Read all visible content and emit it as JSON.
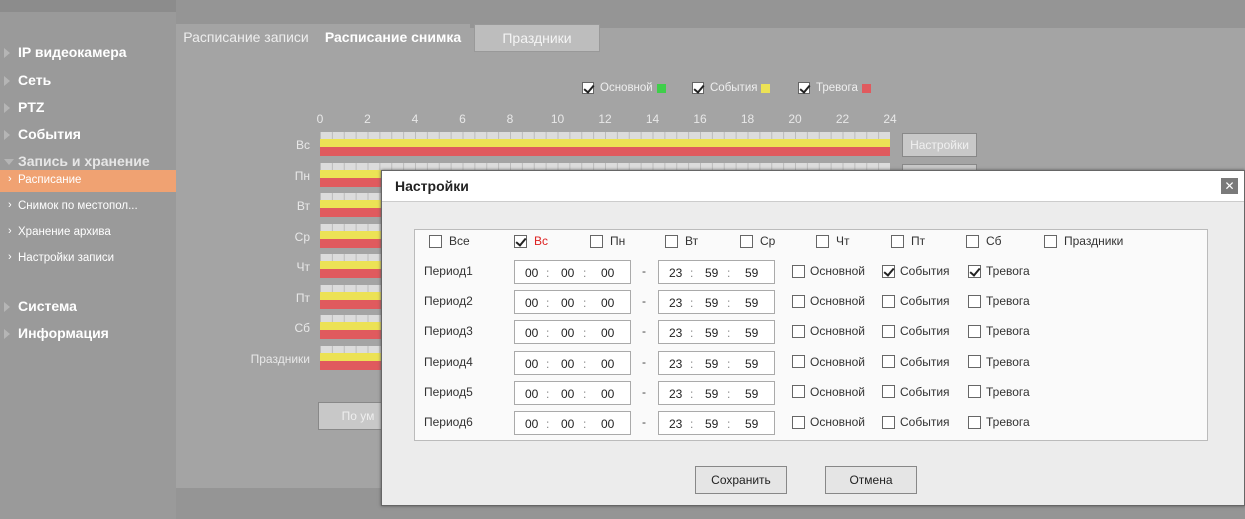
{
  "sidebar": {
    "items": [
      {
        "label": "IP видеокамера"
      },
      {
        "label": "Сеть"
      },
      {
        "label": "PTZ"
      },
      {
        "label": "События"
      },
      {
        "label": "Запись и хранение"
      },
      {
        "label": "Система"
      },
      {
        "label": "Информация"
      }
    ],
    "sub_items": [
      {
        "label": "Расписание",
        "active": true
      },
      {
        "label": "Снимок по местопол..."
      },
      {
        "label": "Хранение архива"
      },
      {
        "label": "Настройки записи"
      }
    ]
  },
  "tabs": [
    {
      "label": "Расписание записи"
    },
    {
      "label": "Расписание снимка",
      "active": true
    },
    {
      "label": "Праздники"
    }
  ],
  "legend": [
    {
      "label": "Основной",
      "checked": true,
      "color": "#3fcf4a"
    },
    {
      "label": "События",
      "checked": true,
      "color": "#ece255"
    },
    {
      "label": "Тревога",
      "checked": true,
      "color": "#e05a5e"
    }
  ],
  "hours": [
    "0",
    "2",
    "4",
    "6",
    "8",
    "10",
    "12",
    "14",
    "16",
    "18",
    "20",
    "22",
    "24"
  ],
  "days": [
    "Вс",
    "Пн",
    "Вт",
    "Ср",
    "Чт",
    "Пт",
    "Сб",
    "Праздники"
  ],
  "settings_button": "Настройки",
  "default_button": "По ум",
  "modal": {
    "title": "Настройки",
    "close": "✕",
    "day_options": [
      {
        "label": "Все",
        "checked": false
      },
      {
        "label": "Вс",
        "checked": true
      },
      {
        "label": "Пн",
        "checked": false
      },
      {
        "label": "Вт",
        "checked": false
      },
      {
        "label": "Ср",
        "checked": false
      },
      {
        "label": "Чт",
        "checked": false
      },
      {
        "label": "Пт",
        "checked": false
      },
      {
        "label": "Сб",
        "checked": false
      },
      {
        "label": "Праздники",
        "checked": false
      }
    ],
    "periods": [
      {
        "name": "Период1",
        "start": [
          "00",
          "00",
          "00"
        ],
        "end": [
          "23",
          "59",
          "59"
        ],
        "main": false,
        "events": true,
        "alarm": true
      },
      {
        "name": "Период2",
        "start": [
          "00",
          "00",
          "00"
        ],
        "end": [
          "23",
          "59",
          "59"
        ],
        "main": false,
        "events": false,
        "alarm": false
      },
      {
        "name": "Период3",
        "start": [
          "00",
          "00",
          "00"
        ],
        "end": [
          "23",
          "59",
          "59"
        ],
        "main": false,
        "events": false,
        "alarm": false
      },
      {
        "name": "Период4",
        "start": [
          "00",
          "00",
          "00"
        ],
        "end": [
          "23",
          "59",
          "59"
        ],
        "main": false,
        "events": false,
        "alarm": false
      },
      {
        "name": "Период5",
        "start": [
          "00",
          "00",
          "00"
        ],
        "end": [
          "23",
          "59",
          "59"
        ],
        "main": false,
        "events": false,
        "alarm": false
      },
      {
        "name": "Период6",
        "start": [
          "00",
          "00",
          "00"
        ],
        "end": [
          "23",
          "59",
          "59"
        ],
        "main": false,
        "events": false,
        "alarm": false
      }
    ],
    "opt_labels": {
      "main": "Основной",
      "events": "События",
      "alarm": "Тревога"
    },
    "time_sep": ":",
    "range_sep": "-",
    "save": "Сохранить",
    "cancel": "Отмена"
  }
}
